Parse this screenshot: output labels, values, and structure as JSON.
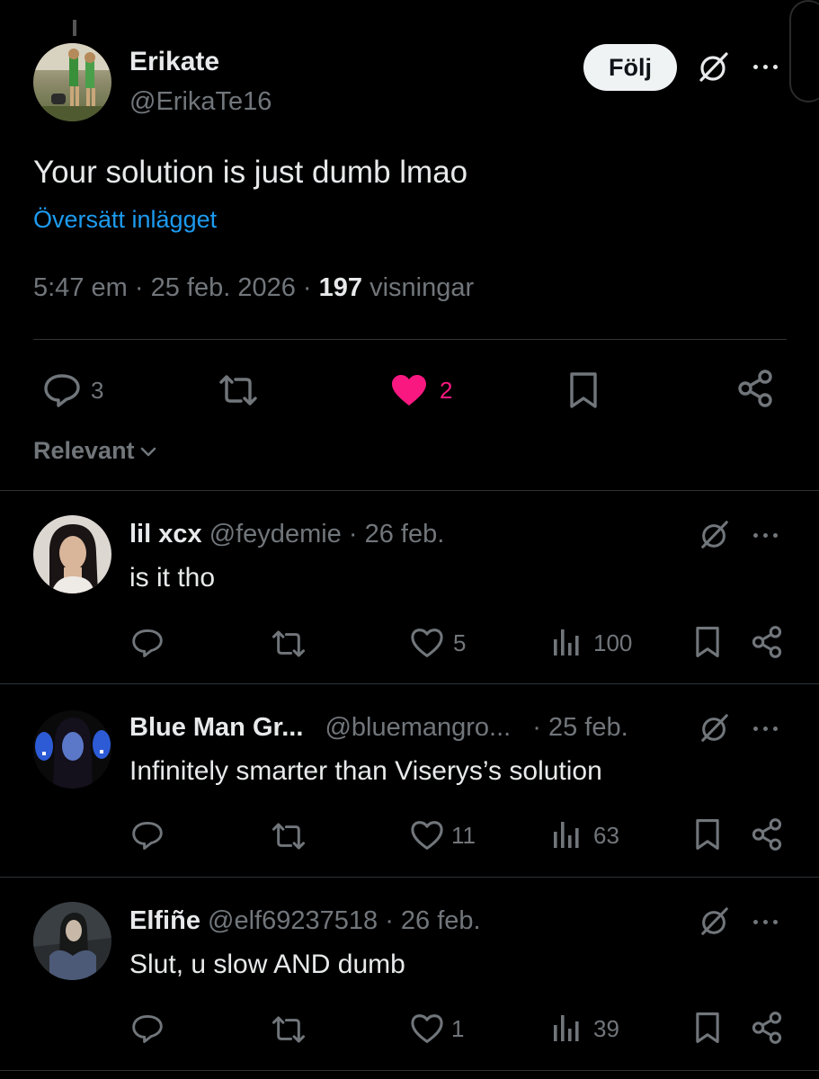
{
  "colors": {
    "background": "#000000",
    "text": "#e7e9ea",
    "muted": "#71767b",
    "link": "#1d9bf0",
    "like_active": "#f91880",
    "divider": "#2f3336"
  },
  "main_post": {
    "display_name": "Erikate",
    "handle": "@ErikaTe16",
    "follow_label": "Följ",
    "text": "Your solution is just dumb lmao",
    "translate_label": "Översätt inlägget",
    "time": "5:47 em",
    "sep1": "·",
    "date": "25 feb. 2026",
    "sep2": "·",
    "views_count": "197",
    "views_label": "visningar",
    "actions": {
      "replies": "3",
      "likes": "2",
      "liked": true
    },
    "icons": [
      "grok-icon",
      "more-icon",
      "reply-icon",
      "repost-icon",
      "heart-filled-icon",
      "bookmark-icon",
      "share-icon"
    ]
  },
  "sort": {
    "label": "Relevant"
  },
  "replies": [
    {
      "display_name": "lil xcx",
      "handle": "@feydemie",
      "date": "· 26 feb.",
      "text": "is it tho",
      "likes": "5",
      "views": "100"
    },
    {
      "display_name": "Blue Man Gr...",
      "handle": "@bluemangro...",
      "date": "· 25 feb.",
      "text": "Infinitely smarter than Viserys’s solution",
      "likes": "11",
      "views": "63"
    },
    {
      "display_name": "Elfiñe",
      "handle": "@elf69237518",
      "date": "· 26 feb.",
      "text": "Slut, u slow AND dumb",
      "likes": "1",
      "views": "39"
    }
  ]
}
